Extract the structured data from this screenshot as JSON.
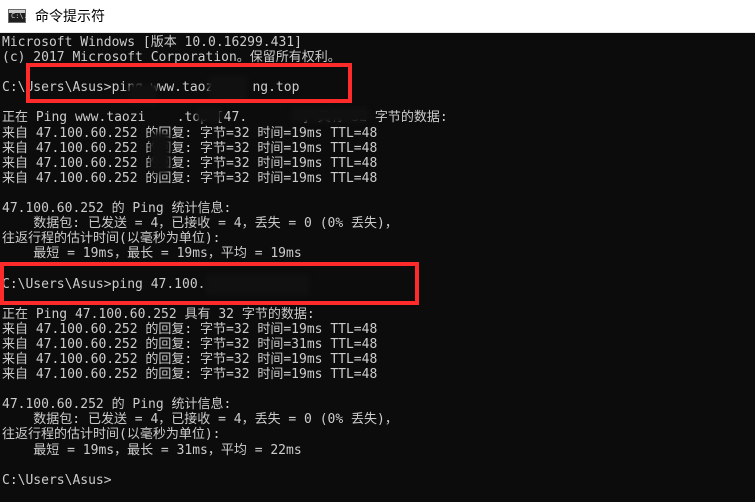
{
  "window": {
    "title": "命令提示符",
    "icon": "cmd-icon",
    "icon_text": "C:\\."
  },
  "colors": {
    "console_bg": "#0c0c0c",
    "console_text": "#cccccc",
    "annotation_red": "#ff2b2b"
  },
  "console": {
    "lines": [
      "Microsoft Windows [版本 10.0.16299.431]",
      "(c) 2017 Microsoft Corporation。保留所有权利。",
      "",
      "C:\\Users\\Asus>ping www.taozi    ng.top",
      "",
      "正在 Ping www.taozi    .top [47.       ] 具有 32 字节的数据:",
      "来自 47.100.60.252 的回复: 字节=32 时间=19ms TTL=48",
      "来自 47.100.60.252 的回复: 字节=32 时间=19ms TTL=48",
      "来自 47.100.60.252 的回复: 字节=32 时间=19ms TTL=48",
      "来自 47.100.60.252 的回复: 字节=32 时间=19ms TTL=48",
      "",
      "47.100.60.252 的 Ping 统计信息:",
      "    数据包: 已发送 = 4，已接收 = 4，丢失 = 0 (0% 丢失)，",
      "往返行程的估计时间(以毫秒为单位):",
      "    最短 = 19ms，最长 = 19ms，平均 = 19ms",
      "",
      "C:\\Users\\Asus>ping 47.100.",
      "",
      "正在 Ping 47.100.60.252 具有 32 字节的数据:",
      "来自 47.100.60.252 的回复: 字节=32 时间=19ms TTL=48",
      "来自 47.100.60.252 的回复: 字节=32 时间=31ms TTL=48",
      "来自 47.100.60.252 的回复: 字节=32 时间=19ms TTL=48",
      "来自 47.100.60.252 的回复: 字节=32 时间=19ms TTL=48",
      "",
      "47.100.60.252 的 Ping 统计信息:",
      "    数据包: 已发送 = 4，已接收 = 4，丢失 = 0 (0% 丢失)，",
      "往返行程的估计时间(以毫秒为单位):",
      "    最短 = 19ms，最长 = 31ms，平均 = 22ms",
      "",
      "C:\\Users\\Asus>"
    ]
  }
}
